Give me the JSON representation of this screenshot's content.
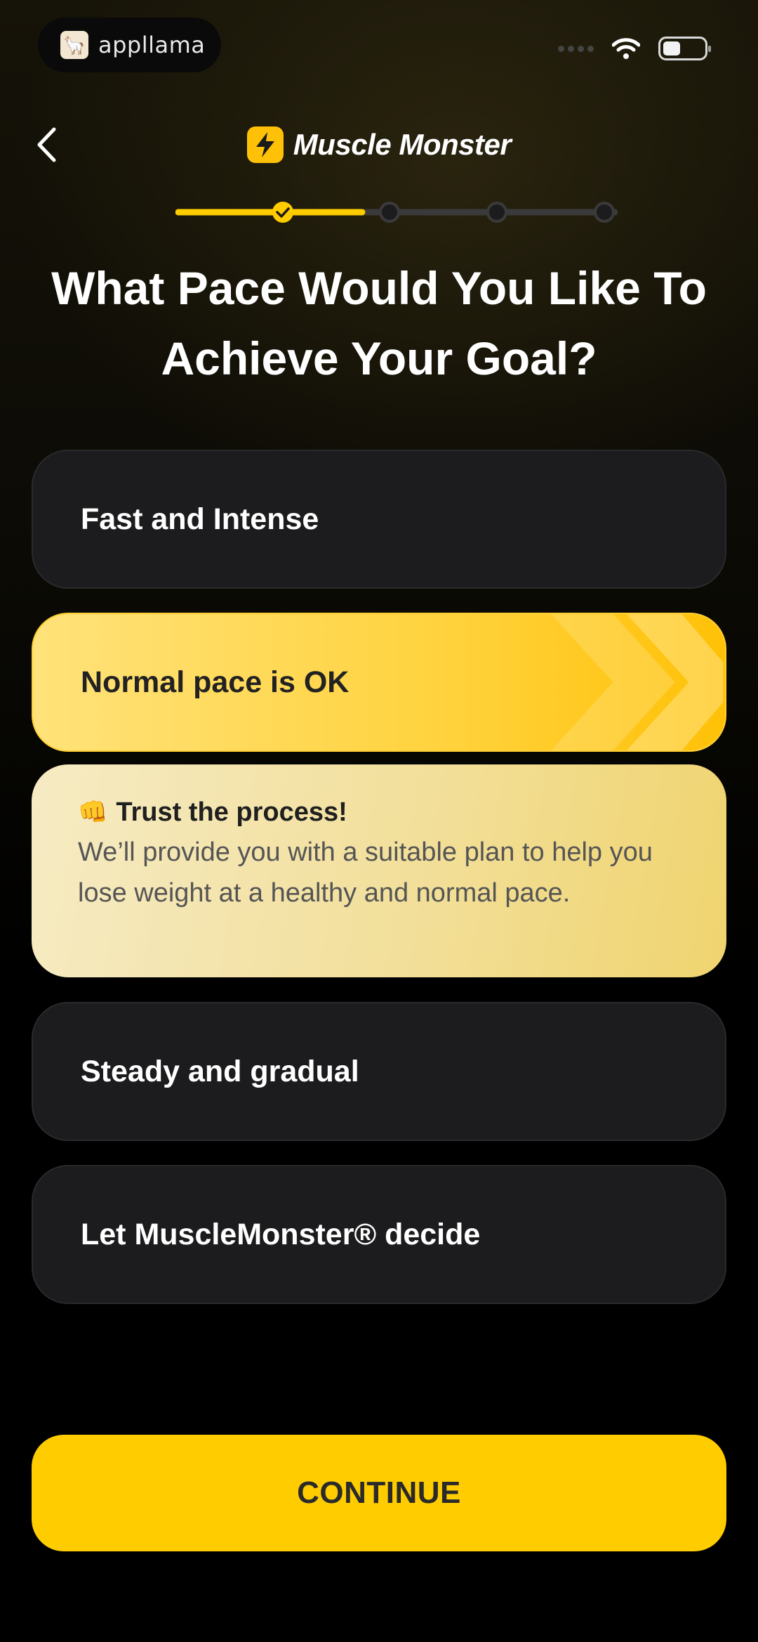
{
  "status_bar": {
    "brand": "appllama"
  },
  "header": {
    "app_name": "Muscle Monster"
  },
  "progress": {
    "total_steps": 5,
    "current_step": 2
  },
  "question": {
    "title": "What Pace Would You Like To Achieve Your Goal?"
  },
  "options": [
    {
      "label": "Fast and Intense",
      "selected": false
    },
    {
      "label": "Normal pace is OK",
      "selected": true
    },
    {
      "label": "Steady and gradual",
      "selected": false
    },
    {
      "label": "Let MuscleMonster® decide",
      "selected": false
    }
  ],
  "tip": {
    "title": "Trust the process!",
    "body": "We’ll provide you with a suitable plan to help you lose weight at a healthy and normal pace."
  },
  "footer": {
    "continue_label": "CONTINUE"
  },
  "colors": {
    "accent": "#ffcc00",
    "card": "#1c1c1e",
    "background": "#000000"
  }
}
